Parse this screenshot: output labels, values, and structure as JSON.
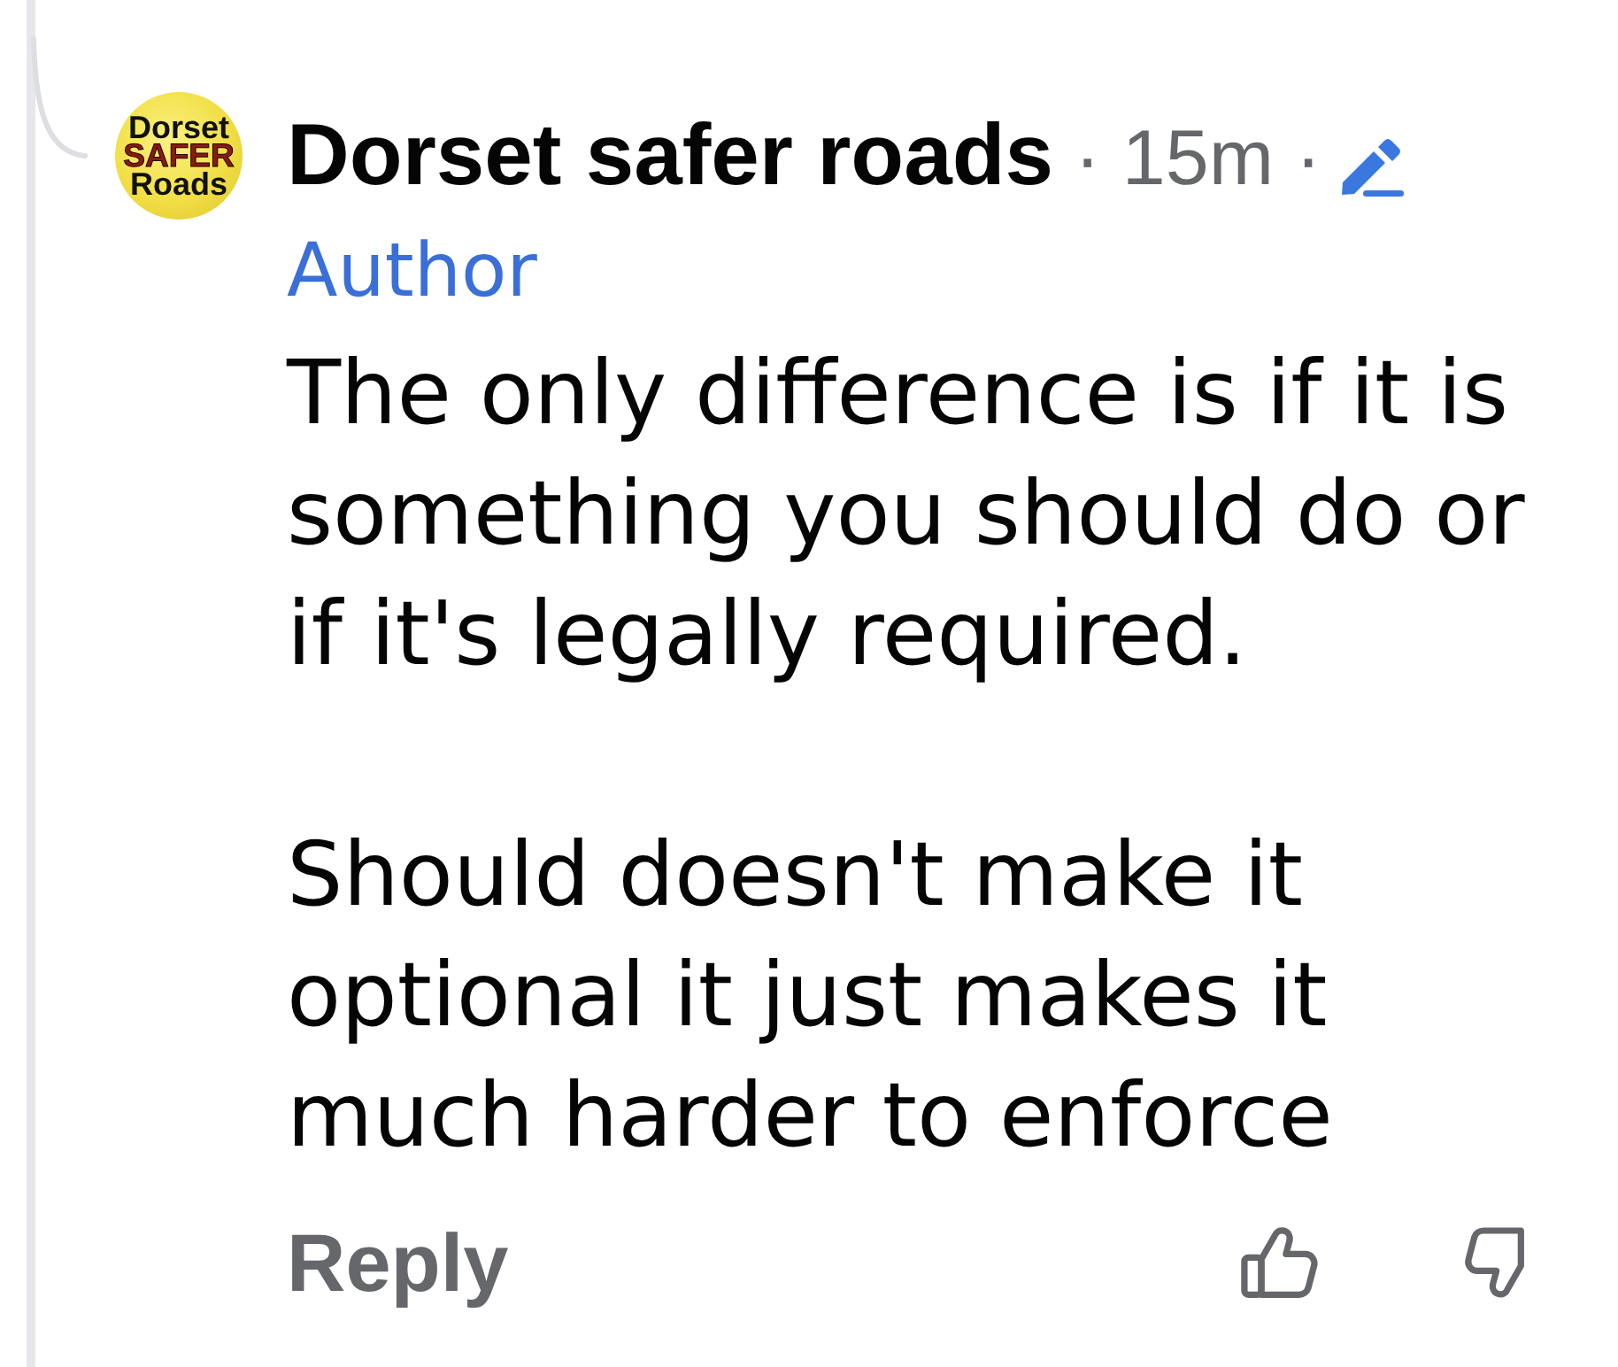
{
  "comment": {
    "avatar": {
      "logo_lines": [
        {
          "text": "Dorset",
          "kind": "plain"
        },
        {
          "text": "SAFER",
          "kind": "accent"
        },
        {
          "text": "Roads",
          "kind": "plain"
        }
      ]
    },
    "author_name": "Dorset safer roads",
    "meta": "· 15m ·",
    "edited": true,
    "role": "Author",
    "paragraphs": [
      "The only difference is if it is something you should do or if it's legally required.",
      "Should doesn't make it optional it just makes it much harder to enforce"
    ],
    "actions": {
      "reply": "Reply"
    }
  }
}
